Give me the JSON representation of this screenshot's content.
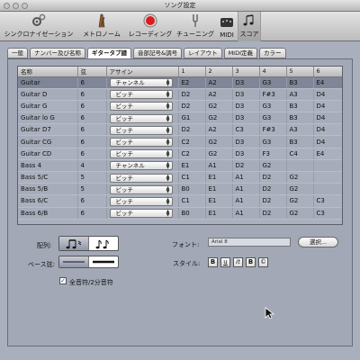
{
  "window": {
    "title": "ソング設定"
  },
  "toolbar": {
    "items": [
      {
        "label": "シンクロナイゼーション",
        "icon": "gears-icon"
      },
      {
        "label": "メトロノーム",
        "icon": "metronome-icon"
      },
      {
        "label": "レコーディング",
        "icon": "record-icon"
      },
      {
        "label": "チューニング",
        "icon": "tuning-fork-icon"
      },
      {
        "label": "MIDI",
        "icon": "midi-port-icon"
      },
      {
        "label": "スコア",
        "icon": "music-notes-icon"
      }
    ],
    "selected": "スコア"
  },
  "tabs": [
    "一般",
    "ナンバー及び名称",
    "ギタータブ譜",
    "音部記号&調号",
    "レイアウト",
    "MIDI定義",
    "カラー"
  ],
  "active_tab": "ギタータブ譜",
  "table": {
    "headers": [
      "名称",
      "弦",
      "アサイン",
      "1",
      "2",
      "3",
      "4",
      "5",
      "6"
    ],
    "rows": [
      [
        "Guitar",
        "6",
        "チャンネル",
        "E2",
        "A2",
        "D3",
        "G3",
        "B3",
        "E4"
      ],
      [
        "Guitar D",
        "6",
        "ピッチ",
        "D2",
        "A2",
        "D3",
        "F#3",
        "A3",
        "D4"
      ],
      [
        "Guitar G",
        "6",
        "ピッチ",
        "D2",
        "G2",
        "D3",
        "G3",
        "B3",
        "D4"
      ],
      [
        "Guitar lo G",
        "6",
        "ピッチ",
        "G1",
        "G2",
        "D3",
        "G3",
        "B3",
        "D4"
      ],
      [
        "Guitar D7",
        "6",
        "ピッチ",
        "D2",
        "A2",
        "C3",
        "F#3",
        "A3",
        "D4"
      ],
      [
        "Guitar CG",
        "6",
        "ピッチ",
        "C2",
        "G2",
        "D3",
        "G3",
        "B3",
        "D4"
      ],
      [
        "Guitar CD",
        "6",
        "ピッチ",
        "C2",
        "G2",
        "D3",
        "F3",
        "C4",
        "E4"
      ],
      [
        "Bass 4",
        "4",
        "チャンネル",
        "E1",
        "A1",
        "D2",
        "G2",
        "",
        ""
      ],
      [
        "Bass 5/C",
        "5",
        "ピッチ",
        "C1",
        "E1",
        "A1",
        "D2",
        "G2",
        ""
      ],
      [
        "Bass 5/B",
        "5",
        "ピッチ",
        "B0",
        "E1",
        "A1",
        "D2",
        "G2",
        ""
      ],
      [
        "Bass 6/C",
        "6",
        "ピッチ",
        "C1",
        "E1",
        "A1",
        "D2",
        "G2",
        "C3"
      ],
      [
        "Bass 6/B",
        "6",
        "ピッチ",
        "B0",
        "E1",
        "A1",
        "D2",
        "G2",
        "C3"
      ]
    ],
    "selected_row": 0
  },
  "settings": {
    "arrangement_label": "配列:",
    "bass_line_label": "ベース弦:",
    "font_label": "フォント:",
    "font_value": "Arial 8",
    "choose_button": "選択...",
    "style_label": "スタイル:",
    "style_buttons": [
      "B",
      "u",
      "it",
      "B",
      "©"
    ],
    "checkbox_label": "全音符/2分音符",
    "checkbox_checked": true
  }
}
